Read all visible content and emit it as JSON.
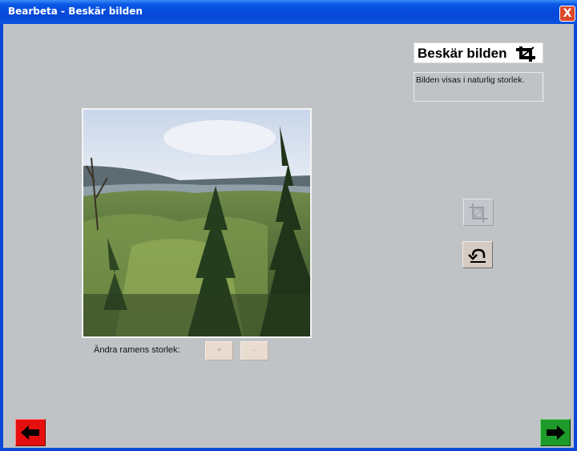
{
  "window": {
    "title": "Bearbeta - Beskär bilden",
    "close_symbol": "X"
  },
  "header": {
    "title": "Beskär bilden",
    "icon": "crop-icon"
  },
  "info": {
    "text": "Bilden visas i naturlig storlek."
  },
  "resize": {
    "label": "Ändra ramens storlek:",
    "plus_label": "+",
    "minus_label": "-"
  },
  "tools": {
    "crop_icon": "crop-frame-icon",
    "undo_icon": "undo-icon"
  },
  "nav": {
    "back_icon": "arrow-left-icon",
    "next_icon": "arrow-right-icon"
  },
  "colors": {
    "titlebar": "#0a49d6",
    "background": "#c0c3c6",
    "back": "#e60f0f",
    "next": "#1e9a2a"
  }
}
